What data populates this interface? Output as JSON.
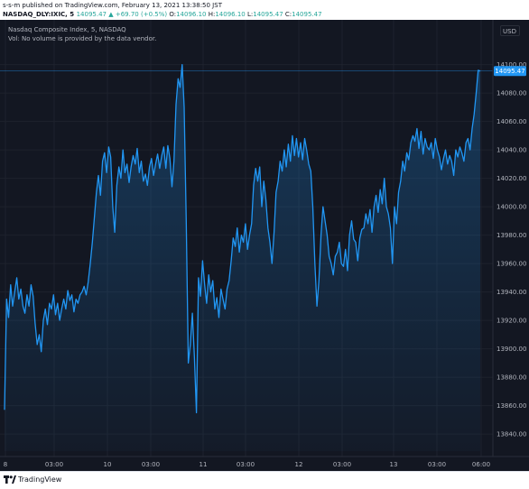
{
  "header": {
    "published": "s-s-m published on TradingView.com, February 13, 2021 13:38:50 JST",
    "symbol": "NASDAQ_DLY:IXIC, 5",
    "last": "14095.47",
    "change": "▲ +69.70 (+0.5%)",
    "o_label": "O:",
    "o_value": "14096.10",
    "h_label": "H:",
    "h_value": "14096.10",
    "l_label": "L:",
    "l_value": "14095.47",
    "c_label": "C:",
    "c_value": "14095.47"
  },
  "legend": {
    "title": "Nasdaq Composite Index, 5, NASDAQ",
    "volume_note": "Vol: No volume is provided by the data vendor."
  },
  "currency": "USD",
  "footer": {
    "brand": "TradingView"
  },
  "colors": {
    "background": "#131722",
    "line": "#2196f3",
    "grid": "#2a2e39",
    "axis_text": "#b2b5be",
    "price_tag": "#2196f3",
    "up": "#26a69a"
  },
  "chart_data": {
    "type": "area",
    "title": "Nasdaq Composite Index, 5, NASDAQ",
    "xlabel": "",
    "ylabel": "",
    "unit": "USD",
    "ylim": [
      13828,
      14108
    ],
    "grid": true,
    "last_price_label": "14095.47",
    "x_tick_labels": [
      "8",
      "03:00",
      "10",
      "03:00",
      "11",
      "03:00",
      "12",
      "03:00",
      "13",
      "03:00",
      "06:00"
    ],
    "y_tick_labels": [
      "14100.00",
      "14080.00",
      "14060.00",
      "14040.00",
      "14020.00",
      "14000.00",
      "13980.00",
      "13960.00",
      "13940.00",
      "13920.00",
      "13900.00",
      "13880.00",
      "13860.00",
      "13840.00"
    ],
    "y_ticks": [
      14100,
      14080,
      14060,
      14040,
      14020,
      14000,
      13980,
      13960,
      13940,
      13920,
      13900,
      13880,
      13860,
      13840
    ],
    "series": [
      {
        "values": [
          13857,
          13935,
          13922,
          13945,
          13930,
          13940,
          13950,
          13935,
          13942,
          13930,
          13925,
          13938,
          13930,
          13945,
          13937,
          13918,
          13903,
          13910,
          13898,
          13920,
          13928,
          13917,
          13932,
          13928,
          13938,
          13924,
          13932,
          13920,
          13928,
          13935,
          13928,
          13941,
          13934,
          13938,
          13926,
          13935,
          13932,
          13938,
          13940,
          13944,
          13938,
          13947,
          13960,
          13975,
          13992,
          14010,
          14022,
          14008,
          14032,
          14038,
          14024,
          14042,
          14035,
          14000,
          13982,
          14015,
          14028,
          14020,
          14040,
          14024,
          14030,
          14017,
          14028,
          14036,
          14030,
          14041,
          14024,
          14032,
          14018,
          14023,
          14015,
          14028,
          14034,
          14022,
          14030,
          14037,
          14027,
          14036,
          14042,
          14027,
          14043,
          14034,
          14014,
          14032,
          14072,
          14090,
          14084,
          14100,
          14070,
          13990,
          13890,
          13903,
          13925,
          13895,
          13855,
          13950,
          13937,
          13962,
          13945,
          13932,
          13952,
          13940,
          13948,
          13928,
          13936,
          13922,
          13942,
          13935,
          13928,
          13942,
          13948,
          13962,
          13978,
          13972,
          13985,
          13968,
          13980,
          13975,
          13988,
          13970,
          13980,
          13988,
          14015,
          14027,
          14018,
          14028,
          14000,
          14018,
          14005,
          13985,
          13975,
          13960,
          13982,
          14010,
          14018,
          14032,
          14025,
          14040,
          14028,
          14044,
          14032,
          14050,
          14036,
          14048,
          14035,
          14045,
          14033,
          14048,
          14040,
          14030,
          14025,
          14000,
          13960,
          13930,
          13948,
          13980,
          14000,
          13990,
          13980,
          13965,
          13960,
          13952,
          13965,
          13968,
          13975,
          13960,
          13958,
          13970,
          13955,
          13980,
          13990,
          13977,
          13975,
          13962,
          13978,
          13984,
          13985,
          13995,
          13988,
          13998,
          13982,
          14000,
          14008,
          13996,
          14012,
          14002,
          14020,
          14000,
          13995,
          13985,
          13960,
          14000,
          13988,
          14010,
          14018,
          14032,
          14025,
          14038,
          14033,
          14045,
          14050,
          14046,
          14055,
          14041,
          14053,
          14037,
          14048,
          14042,
          14040,
          14045,
          14034,
          14048,
          14040,
          14035,
          14026,
          14034,
          14040,
          14030,
          14036,
          14032,
          14022,
          14040,
          14035,
          14042,
          14038,
          14032,
          14045,
          14048,
          14040,
          14055,
          14065,
          14080,
          14096,
          14095.47
        ]
      }
    ]
  }
}
